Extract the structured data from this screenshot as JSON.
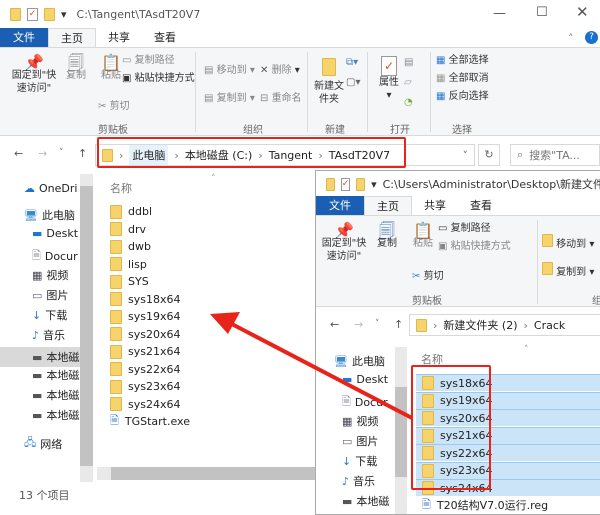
{
  "win1": {
    "path": "C:\\Tangent\\TAsdT20V7",
    "tabs": [
      "文件",
      "主页",
      "共享",
      "查看"
    ],
    "ribbon": {
      "pin": "固定到\"快速访问\"",
      "copy": "复制",
      "paste": "粘贴",
      "copy_path": "复制路径",
      "paste_shortcut": "粘贴快捷方式",
      "cut": "剪切",
      "clipboard": "剪贴板",
      "move_to": "移动到",
      "copy_to": "复制到",
      "delete": "删除",
      "rename": "重命名",
      "organize": "组织",
      "new_folder": "新建文件夹",
      "new": "新建",
      "properties": "属性",
      "open": "打开",
      "select_all": "全部选择",
      "select_none": "全部取消",
      "invert": "反向选择",
      "select": "选择"
    },
    "breadcrumb": [
      "此电脑",
      "本地磁盘 (C:)",
      "Tangent",
      "TAsdT20V7"
    ],
    "search_placeholder": "搜索\"TA...",
    "nav": [
      "OneDri",
      "此电脑",
      "Deskt",
      "Docur",
      "视频",
      "图片",
      "下载",
      "音乐",
      "本地磁",
      "本地磁",
      "本地磁",
      "本地磁",
      "网络"
    ],
    "col_name": "名称",
    "files": [
      "ddbl",
      "drv",
      "dwb",
      "lisp",
      "SYS",
      "sys18x64",
      "sys19x64",
      "sys20x64",
      "sys21x64",
      "sys22x64",
      "sys23x64",
      "sys24x64",
      "TGStart.exe"
    ],
    "status": "13 个项目"
  },
  "win2": {
    "path": "C:\\Users\\Administrator\\Desktop\\新建文件",
    "tabs": [
      "文件",
      "主页",
      "共享",
      "查看"
    ],
    "ribbon": {
      "pin": "固定到\"快速访问\"",
      "copy": "复制",
      "paste": "粘贴",
      "copy_path": "复制路径",
      "paste_shortcut": "粘贴快捷方式",
      "cut": "剪切",
      "clipboard": "剪贴板",
      "move_to": "移动到",
      "copy_to": "复制到",
      "organize": "组"
    },
    "breadcrumb": [
      "新建文件夹 (2)",
      "Crack"
    ],
    "nav": [
      "此电脑",
      "Deskt",
      "Docur",
      "视频",
      "图片",
      "下载",
      "音乐",
      "本地磁"
    ],
    "col_name": "名称",
    "files": [
      "sys18x64",
      "sys19x64",
      "sys20x64",
      "sys21x64",
      "sys22x64",
      "sys23x64",
      "sys24x64",
      "T20结构V7.0运行.reg"
    ]
  },
  "colors": {
    "accent": "#1a5fb4",
    "highlight": "#e8231a",
    "selection": "#cce4f7"
  }
}
